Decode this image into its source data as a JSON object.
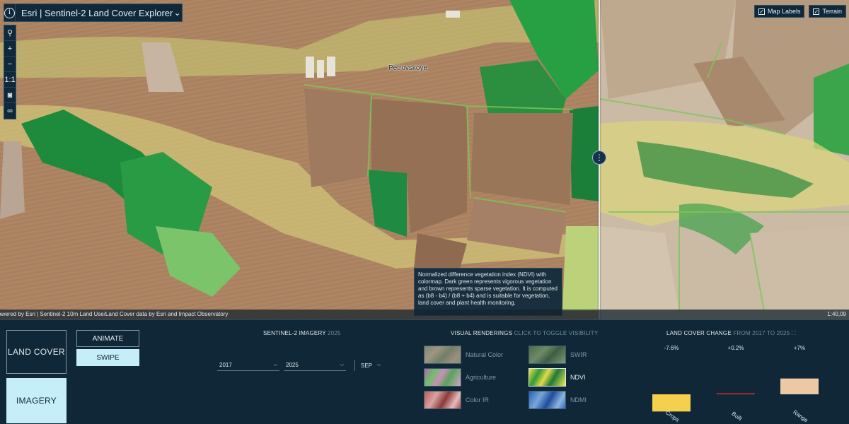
{
  "app": {
    "title": "Esri | Sentinel-2 Land Cover Explorer",
    "info_icon": "info-icon",
    "dropdown_icon": "chevron-down-icon"
  },
  "map": {
    "tools": [
      {
        "name": "search-icon",
        "glyph": "⚲"
      },
      {
        "name": "zoom-in-button",
        "glyph": "+"
      },
      {
        "name": "zoom-out-button",
        "glyph": "−"
      },
      {
        "name": "scale-button",
        "glyph": "1:1"
      },
      {
        "name": "camera-icon",
        "glyph": "◙"
      },
      {
        "name": "link-icon",
        "glyph": "∞"
      }
    ],
    "toggles": [
      {
        "label": "Map Labels",
        "checked": true
      },
      {
        "label": "Terrain",
        "checked": true
      }
    ],
    "place_label": "Petrovskoye",
    "tooltip": "Normalized difference vegetation index (NDVI) with colormap. Dark green represents vigorous vegetation and brown represents sparse vegetation. It is computed as (b8 - b4) / (b8 + b4) and is suitable for vegetation, land cover and plant health monitoring.",
    "attribution": "owered by Esri | Sentinel-2 10m Land Use/Land Cover data by Esri and Impact Observatory",
    "scale": "1:40,09",
    "swipe_handle": "⋮"
  },
  "panel": {
    "mode_land_cover": "LAND COVER",
    "mode_imagery": "IMAGERY",
    "animate": "ANIMATE",
    "swipe": "SWIPE",
    "imagery": {
      "title": "SENTINEL-2 IMAGERY",
      "title_suffix": "2025",
      "year_left": "2017",
      "year_right": "2025",
      "month": "SEP"
    },
    "renderings": {
      "title": "VISUAL RENDERINGS",
      "title_suffix": "CLICK TO TOGGLE VISIBILITY",
      "items": [
        {
          "label": "Natural Color",
          "active": false
        },
        {
          "label": "Agriculture",
          "active": false
        },
        {
          "label": "Color IR",
          "active": false
        },
        {
          "label": "SWIR",
          "active": false
        },
        {
          "label": "NDVI",
          "active": true
        },
        {
          "label": "NDMI",
          "active": false
        }
      ]
    },
    "land_cover_change": {
      "title": "LAND COVER CHANGE",
      "title_suffix": "FROM 2017 TO 2025",
      "expand_icon": "expand-icon"
    }
  },
  "chart_data": {
    "type": "bar",
    "categories": [
      "Crops",
      "Built",
      "Range"
    ],
    "values": [
      -7.6,
      0.2,
      7
    ],
    "value_labels": [
      "-7.6%",
      "+0.2%",
      "+7%"
    ],
    "colors": [
      "#f5d04c",
      "#d92b2b",
      "#ecc8a4"
    ],
    "title": "LAND COVER CHANGE",
    "unit": "%"
  }
}
